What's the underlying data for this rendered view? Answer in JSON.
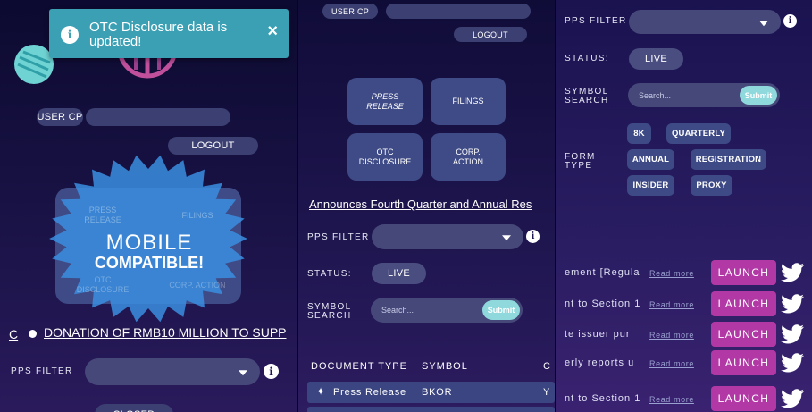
{
  "panel1": {
    "notification": {
      "text": "OTC Disclosure data is updated!",
      "close": "×"
    },
    "user_cp": "USER CP",
    "logout": "LOGOUT",
    "badge": {
      "line1": "MOBILE",
      "line2": "COMPATIBLE!"
    },
    "faded_tiles": [
      "PRESS RELEASE",
      "FILINGS",
      "OTC DISCLOSURE",
      "CORP. ACTION"
    ],
    "ticker_prefix": "C",
    "ticker": "DONATION OF RMB10 MILLION TO SUPP",
    "pps_filter": "PPS FILTER",
    "bottom_pill": "CLOSED"
  },
  "panel2": {
    "user_cp": "USER CP",
    "logout": "LOGOUT",
    "tiles": [
      "PRESS RELEASE",
      "FILINGS",
      "OTC DISCLOSURE",
      "CORP. ACTION"
    ],
    "headline": "Announces Fourth Quarter and Annual Res",
    "pps_filter": "PPS FILTER",
    "status_label": "STATUS:",
    "status_value": "LIVE",
    "symbol_search": {
      "label_l1": "SYMBOL",
      "label_l2": "SEARCH",
      "placeholder": "Search...",
      "submit": "Submit"
    },
    "table": {
      "headers": [
        "DOCUMENT TYPE",
        "SYMBOL",
        "C"
      ],
      "row": {
        "type": "Press Release",
        "symbol": "BKOR",
        "extra": "Y"
      }
    }
  },
  "panel3": {
    "pps_filter": "PPS FILTER",
    "status_label": "STATUS:",
    "status_value": "LIVE",
    "symbol_search": {
      "label_l1": "SYMBOL",
      "label_l2": "SEARCH",
      "placeholder": "Search...",
      "submit": "Submit"
    },
    "form_type": {
      "label_l1": "FORM",
      "label_l2": "TYPE",
      "tags": [
        "8K",
        "QUARTERLY",
        "ANNUAL",
        "REGISTRATION",
        "INSIDER",
        "PROXY"
      ]
    },
    "rows": [
      {
        "text": "ement [Regula",
        "read_more": "Read more",
        "launch": "LAUNCH"
      },
      {
        "text": "nt to Section 1",
        "read_more": "Read more",
        "launch": "LAUNCH"
      },
      {
        "text": "te issuer pur",
        "read_more": "Read more",
        "launch": "LAUNCH"
      },
      {
        "text": "erly reports u",
        "read_more": "Read more",
        "launch": "LAUNCH"
      },
      {
        "text": "nt to Section 1",
        "read_more": "Read more",
        "launch": "LAUNCH"
      }
    ]
  },
  "colors": {
    "launch": "#b238a6",
    "submit": "#8fd8dc",
    "notification": "#3ca0b4",
    "badge": "#3a8ee0"
  }
}
